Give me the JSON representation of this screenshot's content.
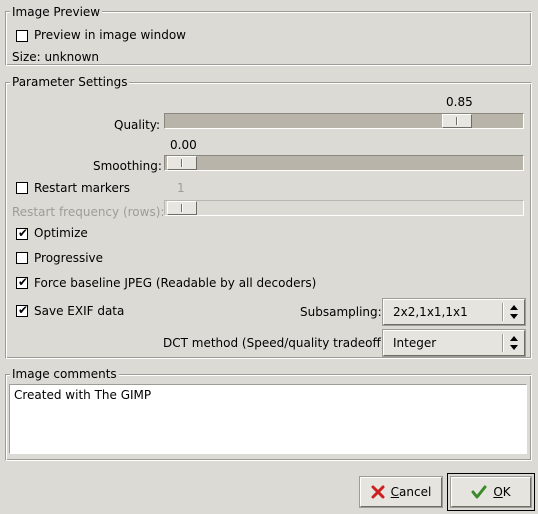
{
  "image_preview": {
    "title": "Image Preview",
    "preview_label": "Preview in image window",
    "preview_checked": false,
    "size_text": "Size: unknown"
  },
  "parameters": {
    "title": "Parameter Settings",
    "quality": {
      "label": "Quality:",
      "value": "0.85",
      "fraction": 0.85
    },
    "smoothing": {
      "label": "Smoothing:",
      "value": "0.00",
      "fraction": 0.0
    },
    "restart_markers": {
      "label": "Restart markers",
      "checked": false
    },
    "restart_frequency": {
      "label": "Restart frequency (rows):",
      "value": "1",
      "fraction": 0.0
    },
    "optimize": {
      "label": "Optimize",
      "checked": true
    },
    "progressive": {
      "label": "Progressive",
      "checked": false
    },
    "force_baseline": {
      "label": "Force baseline JPEG (Readable by all decoders)",
      "checked": true
    },
    "save_exif": {
      "label": "Save EXIF data",
      "checked": true
    },
    "subsampling": {
      "label": "Subsampling:",
      "value": "2x2,1x1,1x1"
    },
    "dct_method": {
      "label": "DCT method (Speed/quality tradeoff):",
      "value": "Integer"
    }
  },
  "comments": {
    "title": "Image comments",
    "text": "Created with The GIMP"
  },
  "buttons": {
    "cancel": {
      "label_mnemonic": "C",
      "label_rest": "ancel",
      "icon": "cancel-x-icon"
    },
    "ok": {
      "label_mnemonic": "O",
      "label_rest": "K",
      "icon": "ok-check-icon"
    }
  },
  "colors": {
    "window_bg": "#dcdad5",
    "cancel_icon": "#cc1f1f",
    "ok_icon": "#3a8a2a"
  }
}
